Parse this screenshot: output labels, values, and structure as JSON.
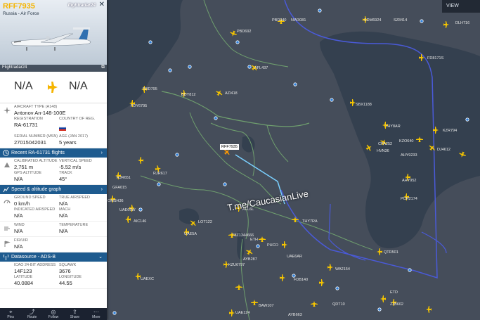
{
  "panel": {
    "callsign": "RFF7935",
    "operator": "Russia - Air Force",
    "brand": "flightradar24",
    "photo_credit": "Flightradar24",
    "origin": "N/A",
    "destination": "N/A",
    "aircraft_type_label": "AIRCRAFT TYPE (A148)",
    "aircraft_type": "Antonov An-148-100E",
    "registration_label": "REGISTRATION",
    "registration": "RA-61731",
    "country_label": "COUNTRY OF REG.",
    "serial_label": "SERIAL NUMBER (MSN)",
    "serial": "27015042031",
    "age_label": "AGE (JAN 2017)",
    "age": "5 years",
    "recent_bar": "Recent RA-61731 flights",
    "cal_alt_label": "CALIBRATED ALTITUDE",
    "cal_alt": "2,751 m",
    "vs_label": "VERTICAL SPEED",
    "vs": "-5.52 m/s",
    "gps_alt_label": "GPS ALTITUDE",
    "gps_alt": "N/A",
    "track_label": "TRACK",
    "track": "45°",
    "speed_bar": "Speed & altitude graph",
    "gs_label": "GROUND SPEED",
    "gs": "0 km/h",
    "tas_label": "TRUE AIRSPEED",
    "tas": "N/A",
    "ias_label": "INDICATED AIRSPEED",
    "ias": "N/A",
    "mach_label": "MACH",
    "mach": "N/A",
    "wind_label": "WIND",
    "wind": "N/A",
    "temp_label": "TEMPERATURE",
    "temp": "N/A",
    "fir_label": "FIR/UIR",
    "fir": "N/A",
    "datasource_bar": "Datasource - ADS-B",
    "icao_label": "ICAO 24-BIT ADDRESS",
    "icao": "14F123",
    "squawk_label": "SQUAWK",
    "squawk": "3676",
    "lat_label": "LATITUDE",
    "lat": "40.0884",
    "lon_label": "LONGITUDE",
    "lon": "44.55"
  },
  "tabs": [
    "Pins",
    "Route",
    "Follow",
    "Share",
    "More"
  ],
  "map": {
    "view_button": "VIEW",
    "watermark": "T.me/CaucasianLive",
    "selected_tag": "RFF7935",
    "flights": [
      "PBD340",
      "NW3081",
      "SDM6924",
      "SZ8414",
      "DLH716",
      "PBD692",
      "FD8171S",
      "AFL437",
      "RBD795",
      "BDY812",
      "AZI418",
      "FDY6795",
      "SBX1188",
      "THY8AR",
      "KZR794",
      "KZO640",
      "CPA252",
      "DJ4612",
      "HVN36",
      "AHY9233",
      "AHY952",
      "PCR2174",
      "RJR617",
      "RJR651",
      "GFA015",
      "OMSH36",
      "UAE65W",
      "AFL6L",
      "LOT122",
      "THY7RA",
      "AIC146",
      "UAE5A",
      "T8Z1344666",
      "ETH",
      "PHCO",
      "AYB287",
      "UAE6AR",
      "QTR501",
      "KZU6797",
      "WA2154",
      "UAEXC",
      "FDB140",
      "QDT10",
      "ETD",
      "ZJB602",
      "UAE124",
      "BAW107",
      "AYB663"
    ]
  },
  "colors": {
    "accent": "#f5b400",
    "bar": "#1e5b8f",
    "sea": "#34404f",
    "land": "#454d5a",
    "border": "#6f9f6e",
    "route": "#4a5ad8"
  }
}
